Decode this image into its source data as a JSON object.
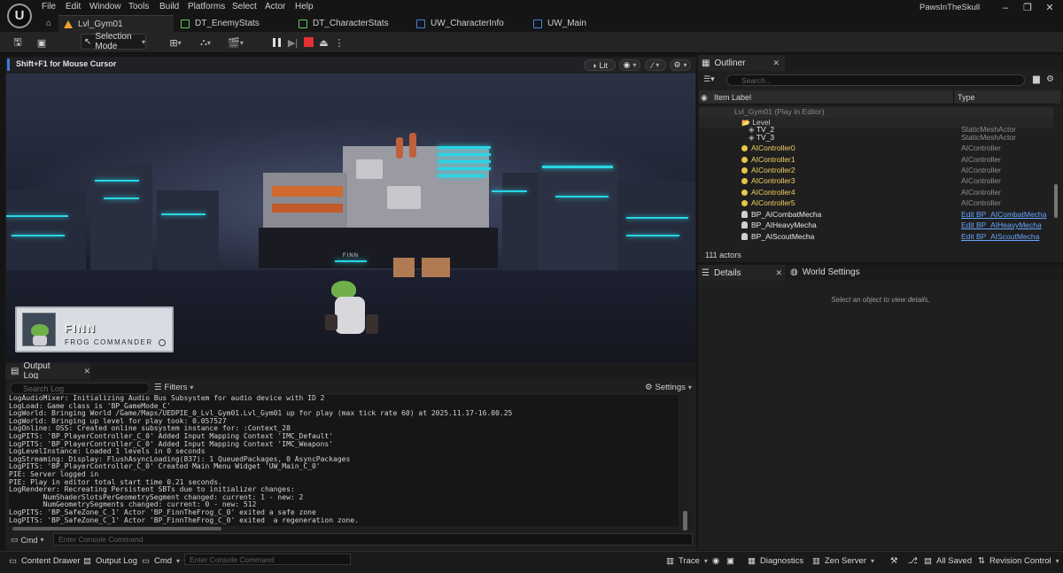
{
  "app": {
    "logo": "U",
    "user": "PawsInTheSkull",
    "menu": [
      "File",
      "Edit",
      "Window",
      "Tools",
      "Build",
      "Platforms",
      "Select",
      "Actor",
      "Help"
    ],
    "tabs": [
      {
        "label": "Lvl_Gym01",
        "color": "#f0a030",
        "active": true
      },
      {
        "label": "DT_EnemyStats",
        "color": "#5ac85a",
        "active": false
      },
      {
        "label": "DT_CharacterStats",
        "color": "#5ac85a",
        "active": false
      },
      {
        "label": "UW_CharacterInfo",
        "color": "#4b7cdf",
        "active": false
      },
      {
        "label": "UW_Main",
        "color": "#4b7cdf",
        "active": false
      }
    ]
  },
  "toolbar": {
    "selection_mode": "Selection Mode"
  },
  "viewport": {
    "hint": "Shift+F1 for Mouse Cursor",
    "lit_label": "Lit",
    "hud": {
      "name": "FINN",
      "subtitle": "FROG COMMANDER",
      "nameplate": "FINN"
    }
  },
  "output_log": {
    "tab_label": "Output Log",
    "search_placeholder": "Search Log",
    "filters_label": "Filters",
    "settings_label": "Settings",
    "lines": [
      "LogAudioMixer: Initializing Audio Bus Subsystem for audio device with ID 2",
      "LogLoad: Game class is 'BP_GameMode_C'",
      "LogWorld: Bringing World /Game/Maps/UEDPIE_0_Lvl_Gym01.Lvl_Gym01 up for play (max tick rate 60) at 2025.11.17-16.00.25",
      "LogWorld: Bringing up level for play took: 0.057527",
      "LogOnline: OSS: Created online subsystem instance for: :Context_28",
      "LogPITS: 'BP_PlayerController_C_0' Added Input Mapping Context 'IMC_Default'",
      "LogPITS: 'BP_PlayerController_C_0' Added Input Mapping Context 'IMC_Weapons'",
      "LogLevelInstance: Loaded 1 levels in 0 seconds",
      "LogStreaming: Display: FlushAsyncLoading(837): 1 QueuedPackages, 0 AsyncPackages",
      "LogPITS: 'BP_PlayerController_C_0' Created Main Menu Widget 'UW_Main_C_0'",
      "PIE: Server logged in",
      "PIE: Play in editor total start time 0.21 seconds.",
      "LogRenderer: Recreating Persistent SBTs due to initializer changes:",
      "        NumShaderSlotsPerGeometrySegment changed: current: 1 - new: 2",
      "        NumGeometrySegments changed: current: 0 - new: 512",
      "LogPITS: 'BP_SafeZone_C_1' Actor 'BP_FinnTheFrog_C_0' exited a safe zone",
      "LogPITS: 'BP_SafeZone_C_1' Actor 'BP_FinnTheFrog_C_0' exited  a regeneration zone."
    ],
    "cmd_label": "Cmd",
    "cmd_placeholder": "Enter Console Command"
  },
  "outliner": {
    "tab_label": "Outliner",
    "search_placeholder": "Search...",
    "col_label": "Item Label",
    "col_type": "Type",
    "rows": [
      {
        "name": "Lvl_Gym01 (Play In Editor)",
        "type": "",
        "kind": "world",
        "indent": 40
      },
      {
        "name": "Level",
        "type": "",
        "kind": "folder",
        "indent": 48
      },
      {
        "name": "TV_2",
        "type": "StaticMeshActor",
        "kind": "mesh",
        "indent": 56
      },
      {
        "name": "TV_3",
        "type": "StaticMeshActor",
        "kind": "mesh",
        "indent": 56
      },
      {
        "name": "AIController0",
        "type": "AIController",
        "kind": "ai",
        "indent": 48
      },
      {
        "name": "AIController1",
        "type": "AIController",
        "kind": "ai",
        "indent": 48
      },
      {
        "name": "AIController2",
        "type": "AIController",
        "kind": "ai",
        "indent": 48
      },
      {
        "name": "AIController3",
        "type": "AIController",
        "kind": "ai",
        "indent": 48
      },
      {
        "name": "AIController4",
        "type": "AIController",
        "kind": "ai",
        "indent": 48
      },
      {
        "name": "AIController5",
        "type": "AIController",
        "kind": "ai",
        "indent": 48
      },
      {
        "name": "BP_AICombatMecha",
        "type": "Edit BP_AICombatMecha",
        "kind": "pawn",
        "indent": 48
      },
      {
        "name": "BP_AIHeavyMecha",
        "type": "Edit BP_AIHeavyMecha",
        "kind": "pawn",
        "indent": 48
      },
      {
        "name": "BP_AIScoutMecha",
        "type": "Edit BP_AIScoutMecha",
        "kind": "pawn",
        "indent": 48
      }
    ],
    "actor_count": "111 actors"
  },
  "details": {
    "tab_label": "Details",
    "world_settings_label": "World Settings",
    "empty_message": "Select an object to view details."
  },
  "statusbar": {
    "content_drawer": "Content Drawer",
    "output_log": "Output Log",
    "cmd": "Cmd",
    "cmd_placeholder": "Enter Console Command",
    "trace": "Trace",
    "diagnostics": "Diagnostics",
    "zen_server": "Zen Server",
    "all_saved": "All Saved",
    "revision_control": "Revision Control"
  }
}
